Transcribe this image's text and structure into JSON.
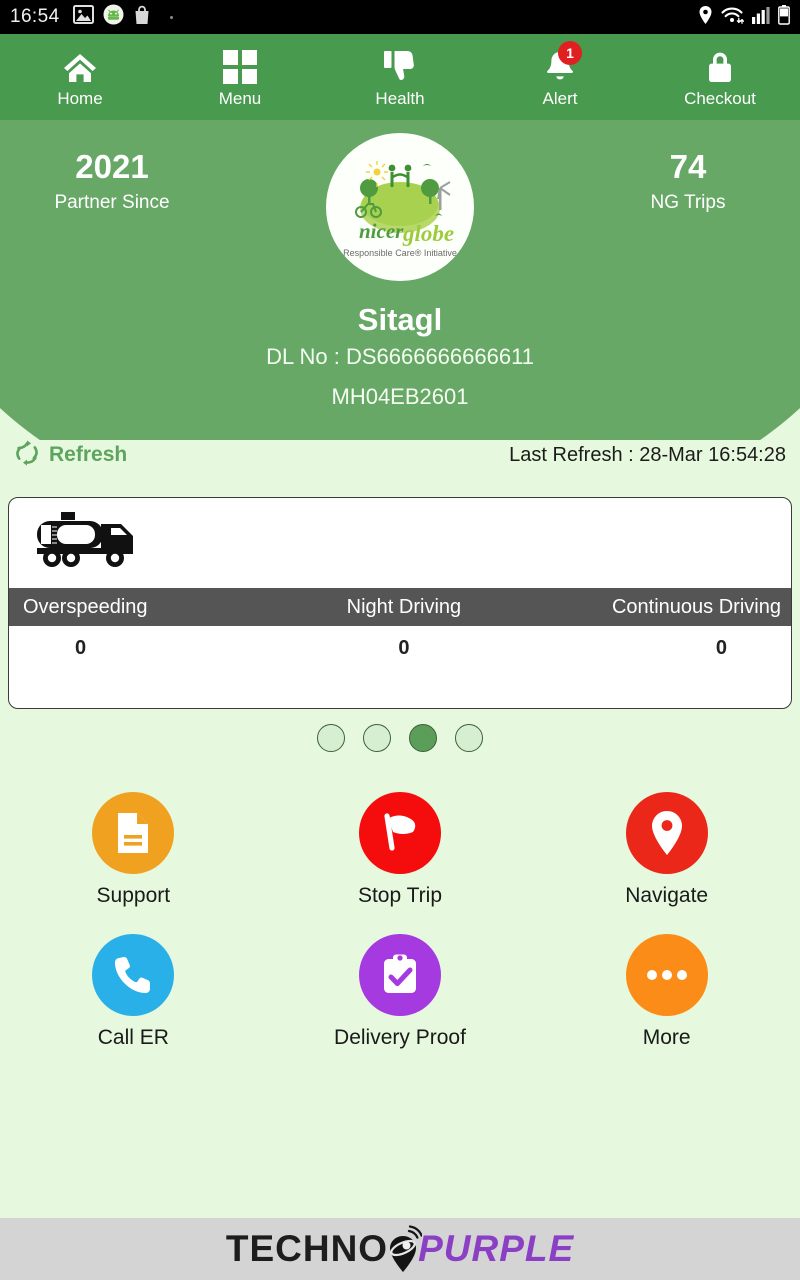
{
  "statusbar": {
    "time": "16:54",
    "left_icons": [
      "image-icon",
      "android-avatar-icon",
      "shopping-bag-icon"
    ],
    "right_icons": [
      "location-pin-icon",
      "wifi-icon",
      "signal-bars-icon",
      "battery-icon"
    ]
  },
  "topnav": {
    "items": [
      {
        "label": "Home",
        "icon": "home-icon",
        "badge": ""
      },
      {
        "label": "Menu",
        "icon": "grid-icon",
        "badge": ""
      },
      {
        "label": "Health",
        "icon": "thumbs-down-icon",
        "badge": ""
      },
      {
        "label": "Alert",
        "icon": "bell-icon",
        "badge": "1"
      },
      {
        "label": "Checkout",
        "icon": "lock-icon",
        "badge": ""
      }
    ],
    "background": "#479a4e"
  },
  "hero": {
    "background": "#67a866",
    "stat_left": {
      "value": "2021",
      "label": "Partner Since"
    },
    "stat_right": {
      "value": "74",
      "label": "NG Trips"
    },
    "logo": {
      "name": "nicerglobe-logo",
      "wordmark_nicer": "nicer",
      "wordmark_globe": "globe",
      "tagline": "Responsible Care® Initiative"
    },
    "driver_name": "Sitagl",
    "driver_dl": "DL No : DS6666666666611",
    "vehicle_number": "MH04EB2601"
  },
  "refresh": {
    "label": "Refresh",
    "icon": "refresh-icon",
    "last_refresh": "Last Refresh : 28-Mar 16:54:28"
  },
  "trip_card": {
    "vehicle_icon": "tanker-truck-icon",
    "columns": [
      "Overspeeding",
      "Night Driving",
      "Continuous Driving"
    ],
    "values": [
      "0",
      "0",
      "0"
    ],
    "header_background": "#555555"
  },
  "pagination": {
    "total": 4,
    "active_index": 2,
    "active_color": "#5a9e5a",
    "inactive_color": "#d6efd0"
  },
  "actions": [
    {
      "label": "Support",
      "icon": "document-icon",
      "color": "#efa11f"
    },
    {
      "label": "Stop Trip",
      "icon": "flag-icon",
      "color": "#f50c0c"
    },
    {
      "label": "Navigate",
      "icon": "map-pin-icon",
      "color": "#ea2718"
    },
    {
      "label": "Call ER",
      "icon": "phone-icon",
      "color": "#29b0e8"
    },
    {
      "label": "Delivery Proof",
      "icon": "clipboard-check-icon",
      "color": "#a53ae0"
    },
    {
      "label": "More",
      "icon": "ellipsis-icon",
      "color": "#fb8c17"
    }
  ],
  "footer": {
    "brand_part1": "TECHNO",
    "brand_part2": "PURPLE",
    "icon": "techno-pin-icon",
    "brand_color": "#8b3fc4"
  }
}
